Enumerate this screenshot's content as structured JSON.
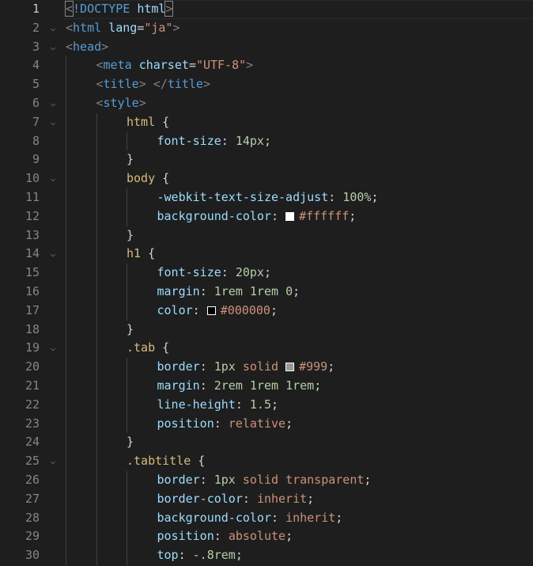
{
  "editor": {
    "lines": [
      {
        "n": "1",
        "fold": false,
        "indent": 0,
        "active": true,
        "tokens": [
          [
            "br",
            "<"
          ],
          [
            "doc",
            "!DOCTYPE"
          ],
          [
            "txt",
            " "
          ],
          [
            "attr",
            "html"
          ],
          [
            "br",
            ">"
          ]
        ]
      },
      {
        "n": "2",
        "fold": true,
        "indent": 0,
        "tokens": [
          [
            "br",
            "<"
          ],
          [
            "tag",
            "html"
          ],
          [
            "txt",
            " "
          ],
          [
            "attr",
            "lang"
          ],
          [
            "txt",
            "="
          ],
          [
            "str",
            "\"ja\""
          ],
          [
            "br",
            ">"
          ]
        ]
      },
      {
        "n": "3",
        "fold": true,
        "indent": 0,
        "tokens": [
          [
            "br",
            "<"
          ],
          [
            "tag",
            "head"
          ],
          [
            "br",
            ">"
          ]
        ]
      },
      {
        "n": "4",
        "fold": false,
        "indent": 1,
        "tokens": [
          [
            "br",
            "<"
          ],
          [
            "tag",
            "meta"
          ],
          [
            "txt",
            " "
          ],
          [
            "attr",
            "charset"
          ],
          [
            "txt",
            "="
          ],
          [
            "str",
            "\"UTF-8\""
          ],
          [
            "br",
            ">"
          ]
        ]
      },
      {
        "n": "5",
        "fold": false,
        "indent": 1,
        "tokens": [
          [
            "br",
            "<"
          ],
          [
            "tag",
            "title"
          ],
          [
            "br",
            ">"
          ],
          [
            "txt",
            " "
          ],
          [
            "br",
            "</"
          ],
          [
            "tag",
            "title"
          ],
          [
            "br",
            ">"
          ]
        ]
      },
      {
        "n": "6",
        "fold": true,
        "indent": 1,
        "tokens": [
          [
            "br",
            "<"
          ],
          [
            "tag",
            "style"
          ],
          [
            "br",
            ">"
          ]
        ]
      },
      {
        "n": "7",
        "fold": true,
        "indent": 2,
        "tokens": [
          [
            "sel",
            "html"
          ],
          [
            "txt",
            " {"
          ]
        ]
      },
      {
        "n": "8",
        "fold": false,
        "indent": 3,
        "tokens": [
          [
            "prop",
            "font-size"
          ],
          [
            "txt",
            ": "
          ],
          [
            "num",
            "14px"
          ],
          [
            "txt",
            ";"
          ]
        ]
      },
      {
        "n": "9",
        "fold": false,
        "indent": 2,
        "tokens": [
          [
            "txt",
            "}"
          ]
        ]
      },
      {
        "n": "10",
        "fold": true,
        "indent": 2,
        "tokens": [
          [
            "sel",
            "body"
          ],
          [
            "txt",
            " {"
          ]
        ]
      },
      {
        "n": "11",
        "fold": false,
        "indent": 3,
        "tokens": [
          [
            "prop",
            "-webkit-text-size-adjust"
          ],
          [
            "txt",
            ": "
          ],
          [
            "num",
            "100%"
          ],
          [
            "txt",
            ";"
          ]
        ]
      },
      {
        "n": "12",
        "fold": false,
        "indent": 3,
        "tokens": [
          [
            "prop",
            "background-color"
          ],
          [
            "txt",
            ": "
          ],
          [
            "swatch",
            "#ffffff"
          ],
          [
            "val",
            "#ffffff"
          ],
          [
            "txt",
            ";"
          ]
        ]
      },
      {
        "n": "13",
        "fold": false,
        "indent": 2,
        "tokens": [
          [
            "txt",
            "}"
          ]
        ]
      },
      {
        "n": "14",
        "fold": true,
        "indent": 2,
        "tokens": [
          [
            "sel",
            "h1"
          ],
          [
            "txt",
            " {"
          ]
        ]
      },
      {
        "n": "15",
        "fold": false,
        "indent": 3,
        "tokens": [
          [
            "prop",
            "font-size"
          ],
          [
            "txt",
            ": "
          ],
          [
            "num",
            "20px"
          ],
          [
            "txt",
            ";"
          ]
        ]
      },
      {
        "n": "16",
        "fold": false,
        "indent": 3,
        "tokens": [
          [
            "prop",
            "margin"
          ],
          [
            "txt",
            ": "
          ],
          [
            "num",
            "1rem"
          ],
          [
            "txt",
            " "
          ],
          [
            "num",
            "1rem"
          ],
          [
            "txt",
            " "
          ],
          [
            "num",
            "0"
          ],
          [
            "txt",
            ";"
          ]
        ]
      },
      {
        "n": "17",
        "fold": false,
        "indent": 3,
        "tokens": [
          [
            "prop",
            "color"
          ],
          [
            "txt",
            ": "
          ],
          [
            "swatch",
            "#000000"
          ],
          [
            "val",
            "#000000"
          ],
          [
            "txt",
            ";"
          ]
        ]
      },
      {
        "n": "18",
        "fold": false,
        "indent": 2,
        "tokens": [
          [
            "txt",
            "}"
          ]
        ]
      },
      {
        "n": "19",
        "fold": true,
        "indent": 2,
        "tokens": [
          [
            "sel",
            ".tab"
          ],
          [
            "txt",
            " {"
          ]
        ]
      },
      {
        "n": "20",
        "fold": false,
        "indent": 3,
        "tokens": [
          [
            "prop",
            "border"
          ],
          [
            "txt",
            ": "
          ],
          [
            "num",
            "1px"
          ],
          [
            "txt",
            " "
          ],
          [
            "val",
            "solid"
          ],
          [
            "txt",
            " "
          ],
          [
            "swatch",
            "#999999"
          ],
          [
            "val",
            "#999"
          ],
          [
            "txt",
            ";"
          ]
        ]
      },
      {
        "n": "21",
        "fold": false,
        "indent": 3,
        "tokens": [
          [
            "prop",
            "margin"
          ],
          [
            "txt",
            ": "
          ],
          [
            "num",
            "2rem"
          ],
          [
            "txt",
            " "
          ],
          [
            "num",
            "1rem"
          ],
          [
            "txt",
            " "
          ],
          [
            "num",
            "1rem"
          ],
          [
            "txt",
            ";"
          ]
        ]
      },
      {
        "n": "22",
        "fold": false,
        "indent": 3,
        "tokens": [
          [
            "prop",
            "line-height"
          ],
          [
            "txt",
            ": "
          ],
          [
            "num",
            "1.5"
          ],
          [
            "txt",
            ";"
          ]
        ]
      },
      {
        "n": "23",
        "fold": false,
        "indent": 3,
        "tokens": [
          [
            "prop",
            "position"
          ],
          [
            "txt",
            ": "
          ],
          [
            "val",
            "relative"
          ],
          [
            "txt",
            ";"
          ]
        ]
      },
      {
        "n": "24",
        "fold": false,
        "indent": 2,
        "tokens": [
          [
            "txt",
            "}"
          ]
        ]
      },
      {
        "n": "25",
        "fold": true,
        "indent": 2,
        "tokens": [
          [
            "sel",
            ".tabtitle"
          ],
          [
            "txt",
            " {"
          ]
        ]
      },
      {
        "n": "26",
        "fold": false,
        "indent": 3,
        "tokens": [
          [
            "prop",
            "border"
          ],
          [
            "txt",
            ": "
          ],
          [
            "num",
            "1px"
          ],
          [
            "txt",
            " "
          ],
          [
            "val",
            "solid"
          ],
          [
            "txt",
            " "
          ],
          [
            "val",
            "transparent"
          ],
          [
            "txt",
            ";"
          ]
        ]
      },
      {
        "n": "27",
        "fold": false,
        "indent": 3,
        "tokens": [
          [
            "prop",
            "border-color"
          ],
          [
            "txt",
            ": "
          ],
          [
            "val",
            "inherit"
          ],
          [
            "txt",
            ";"
          ]
        ]
      },
      {
        "n": "28",
        "fold": false,
        "indent": 3,
        "tokens": [
          [
            "prop",
            "background-color"
          ],
          [
            "txt",
            ": "
          ],
          [
            "val",
            "inherit"
          ],
          [
            "txt",
            ";"
          ]
        ]
      },
      {
        "n": "29",
        "fold": false,
        "indent": 3,
        "tokens": [
          [
            "prop",
            "position"
          ],
          [
            "txt",
            ": "
          ],
          [
            "val",
            "absolute"
          ],
          [
            "txt",
            ";"
          ]
        ]
      },
      {
        "n": "30",
        "fold": false,
        "indent": 3,
        "tokens": [
          [
            "prop",
            "top"
          ],
          [
            "txt",
            ": "
          ],
          [
            "num",
            "-.8rem"
          ],
          [
            "txt",
            ";"
          ]
        ]
      }
    ],
    "colors": {
      "background": "#1e1e1e",
      "tag": "#569cd6",
      "attribute": "#9cdcfe",
      "string": "#ce9178",
      "selector": "#d7ba7d",
      "number": "#b5cea8"
    },
    "fold_icon": "chevron-down-icon",
    "fold_glyph": "⌵"
  }
}
